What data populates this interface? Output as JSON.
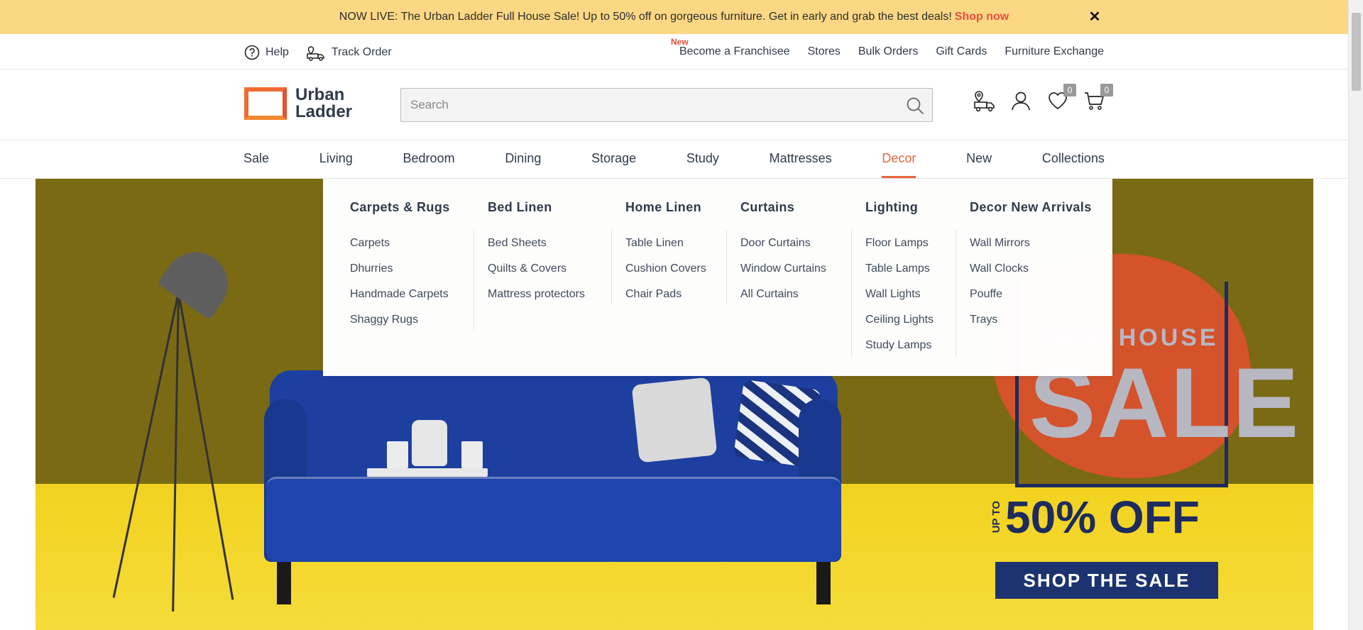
{
  "announcement": {
    "text": "NOW LIVE: The Urban Ladder Full House Sale! Up to 50% off on gorgeous furniture. Get in early and grab the best deals!",
    "link": "Shop now",
    "close": "✕"
  },
  "utility": {
    "help": "Help",
    "track_order": "Track Order",
    "new_tag": "New",
    "right_links": [
      "Become a Franchisee",
      "Stores",
      "Bulk Orders",
      "Gift Cards",
      "Furniture Exchange"
    ]
  },
  "header": {
    "logo_line1": "Urban",
    "logo_line2": "Ladder",
    "search_placeholder": "Search",
    "wishlist_count": "0",
    "cart_count": "0"
  },
  "nav": [
    "Sale",
    "Living",
    "Bedroom",
    "Dining",
    "Storage",
    "Study",
    "Mattresses",
    "Decor",
    "New",
    "Collections"
  ],
  "nav_active": "Decor",
  "mega_menu": [
    {
      "title": "Carpets & Rugs",
      "links": [
        "Carpets",
        "Dhurries",
        "Handmade Carpets",
        "Shaggy Rugs"
      ]
    },
    {
      "title": "Bed Linen",
      "links": [
        "Bed Sheets",
        "Quilts & Covers",
        "Mattress protectors"
      ]
    },
    {
      "title": "Home Linen",
      "links": [
        "Table Linen",
        "Cushion Covers",
        "Chair Pads"
      ]
    },
    {
      "title": "Curtains",
      "links": [
        "Door Curtains",
        "Window Curtains",
        "All Curtains"
      ]
    },
    {
      "title": "Lighting",
      "links": [
        "Floor Lamps",
        "Table Lamps",
        "Wall Lights",
        "Ceiling Lights",
        "Study Lamps"
      ]
    },
    {
      "title": "Decor New Arrivals",
      "links": [
        "Wall Mirrors",
        "Wall Clocks",
        "Pouffe",
        "Trays"
      ]
    }
  ],
  "hero": {
    "sale_top": "FULL HOUSE",
    "sale_word": "SALE",
    "upto": "UP TO",
    "discount": "50% OFF",
    "cta": "SHOP THE SALE"
  },
  "colors": {
    "announcement_bg": "#fcd884",
    "accent": "#e9653e",
    "text": "#2f3b4a",
    "cta_bg": "#1d3370"
  }
}
